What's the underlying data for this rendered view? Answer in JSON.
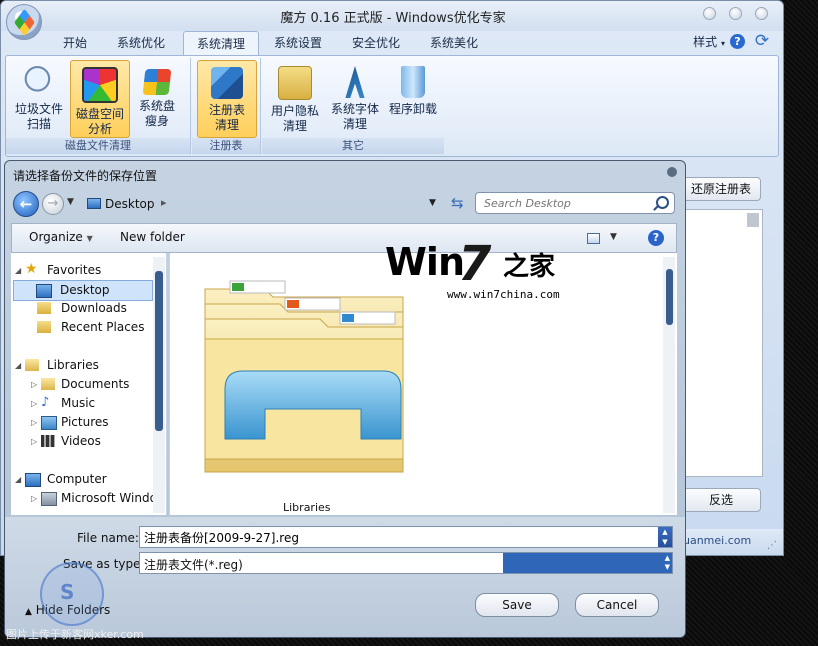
{
  "app": {
    "title": "魔方 0.16 正式版 - Windows优化专家",
    "tabs": [
      "开始",
      "系统优化",
      "系统清理",
      "系统设置",
      "安全优化",
      "系统美化"
    ],
    "active_tab": "系统清理",
    "style_menu": "样式",
    "help_icon": "?",
    "ribbon": {
      "group1": {
        "label": "磁盘文件清理",
        "buttons": [
          {
            "line1": "垃圾文件",
            "line2": "扫描",
            "icon": "magnifier-icon"
          },
          {
            "line1": "磁盘空间",
            "line2": "分析",
            "icon": "disk-space-icon"
          },
          {
            "line1": "系统盘",
            "line2": "瘦身",
            "icon": "windows-flag-icon"
          }
        ]
      },
      "group2": {
        "label": "注册表",
        "buttons": [
          {
            "line1": "注册表",
            "line2": "清理",
            "icon": "registry-cubes-icon"
          }
        ]
      },
      "group3": {
        "label": "其它",
        "buttons": [
          {
            "line1": "用户隐私",
            "line2": "清理",
            "icon": "lock-folder-icon"
          },
          {
            "line1": "系统字体",
            "line2": "清理",
            "icon": "font-icon"
          },
          {
            "line1": "程序卸载",
            "line2": "",
            "icon": "recycle-bin-icon"
          }
        ]
      }
    },
    "side_button_top": "还原注册表",
    "side_button_bottom": "反选",
    "site_text": "uanmei.com"
  },
  "dialog": {
    "title": "请选择备份文件的保存位置",
    "address": "Desktop",
    "search_placeholder": "Search Desktop",
    "organize": "Organize",
    "new_folder": "New folder",
    "help": "?",
    "nav": [
      {
        "label": "Favorites",
        "icon": "star-icon",
        "indent": 0
      },
      {
        "label": "Desktop",
        "icon": "desktop-icon",
        "indent": 1,
        "selected": true
      },
      {
        "label": "Downloads",
        "icon": "downloads-icon",
        "indent": 1
      },
      {
        "label": "Recent Places",
        "icon": "recent-places-icon",
        "indent": 1
      },
      {
        "label": "Libraries",
        "icon": "libraries-icon",
        "indent": 0
      },
      {
        "label": "Documents",
        "icon": "documents-icon",
        "indent": 1
      },
      {
        "label": "Music",
        "icon": "music-icon",
        "indent": 1
      },
      {
        "label": "Pictures",
        "icon": "pictures-icon",
        "indent": 1
      },
      {
        "label": "Videos",
        "icon": "videos-icon",
        "indent": 1
      },
      {
        "label": "Computer",
        "icon": "computer-icon",
        "indent": 0
      },
      {
        "label": "Microsoft Windo",
        "icon": "drive-icon",
        "indent": 1
      }
    ],
    "file_item_label": "Libraries",
    "file_name_label": "File name:",
    "file_name_value": "注册表备份[2009-9-27].reg",
    "save_type_label": "Save as type:",
    "save_type_value": "注册表文件(*.reg)",
    "hide_folders": "Hide Folders",
    "save": "Save",
    "cancel": "Cancel"
  },
  "watermark": {
    "brand": "Win",
    "brand_seven": "7",
    "brand_cn": "之家",
    "url": "www.win7china.com"
  },
  "upload_caption": "图片上传于新客网xker.com",
  "seal_text": "S"
}
